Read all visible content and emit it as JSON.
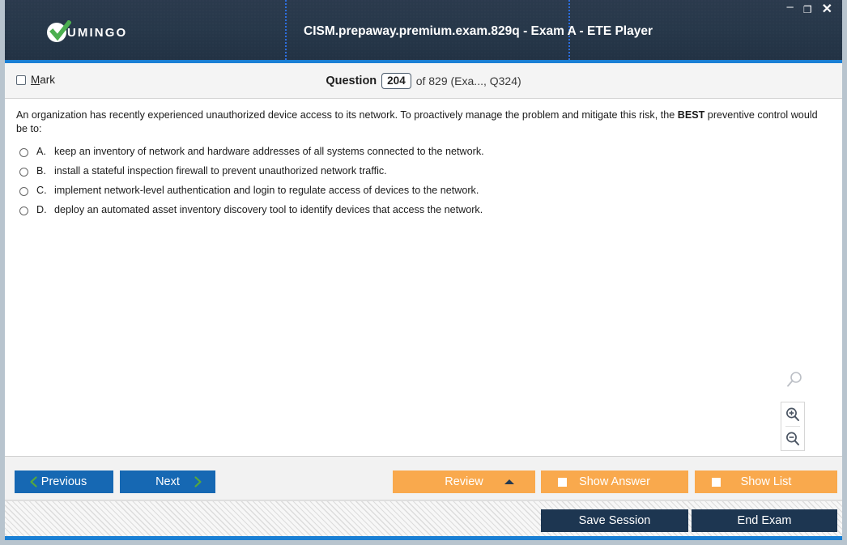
{
  "window": {
    "logo_text": "UMINGO",
    "logo_icon": "check-circle-logo",
    "title": "CISM.prepaway.premium.exam.829q - Exam A - ETE Player",
    "controls": {
      "minimize": "–",
      "maximize": "❐",
      "close": "✕"
    }
  },
  "question_bar": {
    "mark_label_prefix": "",
    "mark_label": "Mark",
    "mark_mnemonic": "M",
    "mark_label_rest": "ark",
    "mark_checked": false,
    "question_word": "Question",
    "question_number": "204",
    "rest": "of 829 (Exa..., Q324)"
  },
  "question": {
    "text_part1": "An organization has recently experienced unauthorized device access to its network. To proactively manage the problem and mitigate this risk, the ",
    "emphasis": "BEST",
    "text_part2": " preventive control would be to:",
    "options": [
      {
        "letter": "A.",
        "text": "keep an inventory of network and hardware addresses of all systems connected to the network.",
        "selected": false
      },
      {
        "letter": "B.",
        "text": "install a stateful inspection firewall to prevent unauthorized network traffic.",
        "selected": false
      },
      {
        "letter": "C.",
        "text": "implement network-level authentication and login to regulate access of devices to the network.",
        "selected": false
      },
      {
        "letter": "D.",
        "text": "deploy an automated asset inventory discovery tool to identify devices that access the network.",
        "selected": false
      }
    ]
  },
  "zoom_tools": {
    "loose_icon": "magnifier-icon",
    "zoom_in_icon": "zoom-in-icon",
    "zoom_out_icon": "zoom-out-icon"
  },
  "toolbar": {
    "previous": "Previous",
    "next": "Next",
    "review": "Review",
    "show_answer": "Show Answer",
    "show_list": "Show List",
    "save_session": "Save Session",
    "end_exam": "End Exam"
  },
  "colors": {
    "header_navy": "#27384a",
    "accent_blue": "#1a7fd4",
    "button_blue": "#1668b3",
    "button_orange": "#f9a94d",
    "button_dark": "#1d3651",
    "chevron_green": "#57a83c",
    "logo_green": "#4caf50"
  }
}
